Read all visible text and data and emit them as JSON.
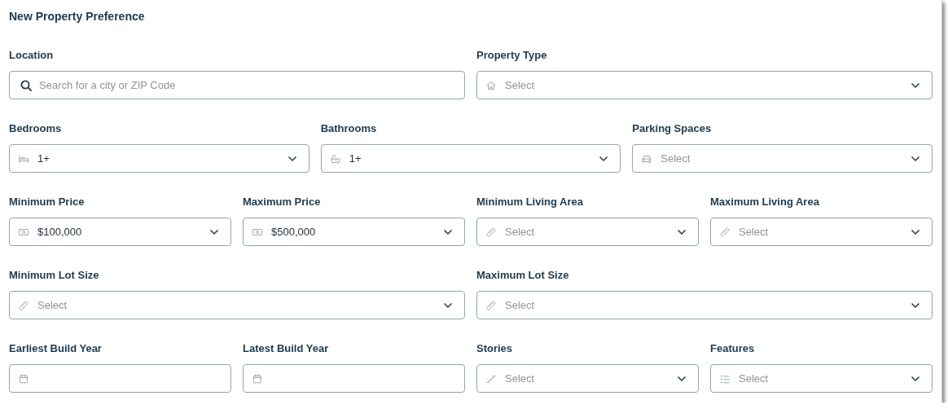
{
  "form": {
    "title": "New Property Preference",
    "rows": [
      [
        {
          "label": "Location",
          "kind": "search",
          "placeholder": "Search for a city or ZIP Code"
        },
        {
          "label": "Property Type",
          "kind": "select",
          "placeholder": "Select"
        }
      ],
      [
        {
          "label": "Bedrooms",
          "kind": "select",
          "value": "1+"
        },
        {
          "label": "Bathrooms",
          "kind": "select",
          "value": "1+"
        },
        {
          "label": "Parking Spaces",
          "kind": "select",
          "placeholder": "Select"
        }
      ],
      [
        {
          "label": "Minimum Price",
          "kind": "select",
          "value": "$100,000"
        },
        {
          "label": "Maximum Price",
          "kind": "select",
          "value": "$500,000"
        },
        {
          "label": "Minimum Living Area",
          "kind": "select",
          "placeholder": "Select"
        },
        {
          "label": "Maximum Living Area",
          "kind": "select",
          "placeholder": "Select"
        }
      ],
      [
        {
          "label": "Minimum Lot Size",
          "kind": "select",
          "placeholder": "Select"
        },
        {
          "label": "Maximum Lot Size",
          "kind": "select",
          "placeholder": "Select"
        }
      ],
      [
        {
          "label": "Earliest Build Year",
          "kind": "date"
        },
        {
          "label": "Latest Build Year",
          "kind": "date"
        },
        {
          "label": "Stories",
          "kind": "select",
          "placeholder": "Select"
        },
        {
          "label": "Features",
          "kind": "select",
          "placeholder": "Select"
        }
      ]
    ]
  }
}
